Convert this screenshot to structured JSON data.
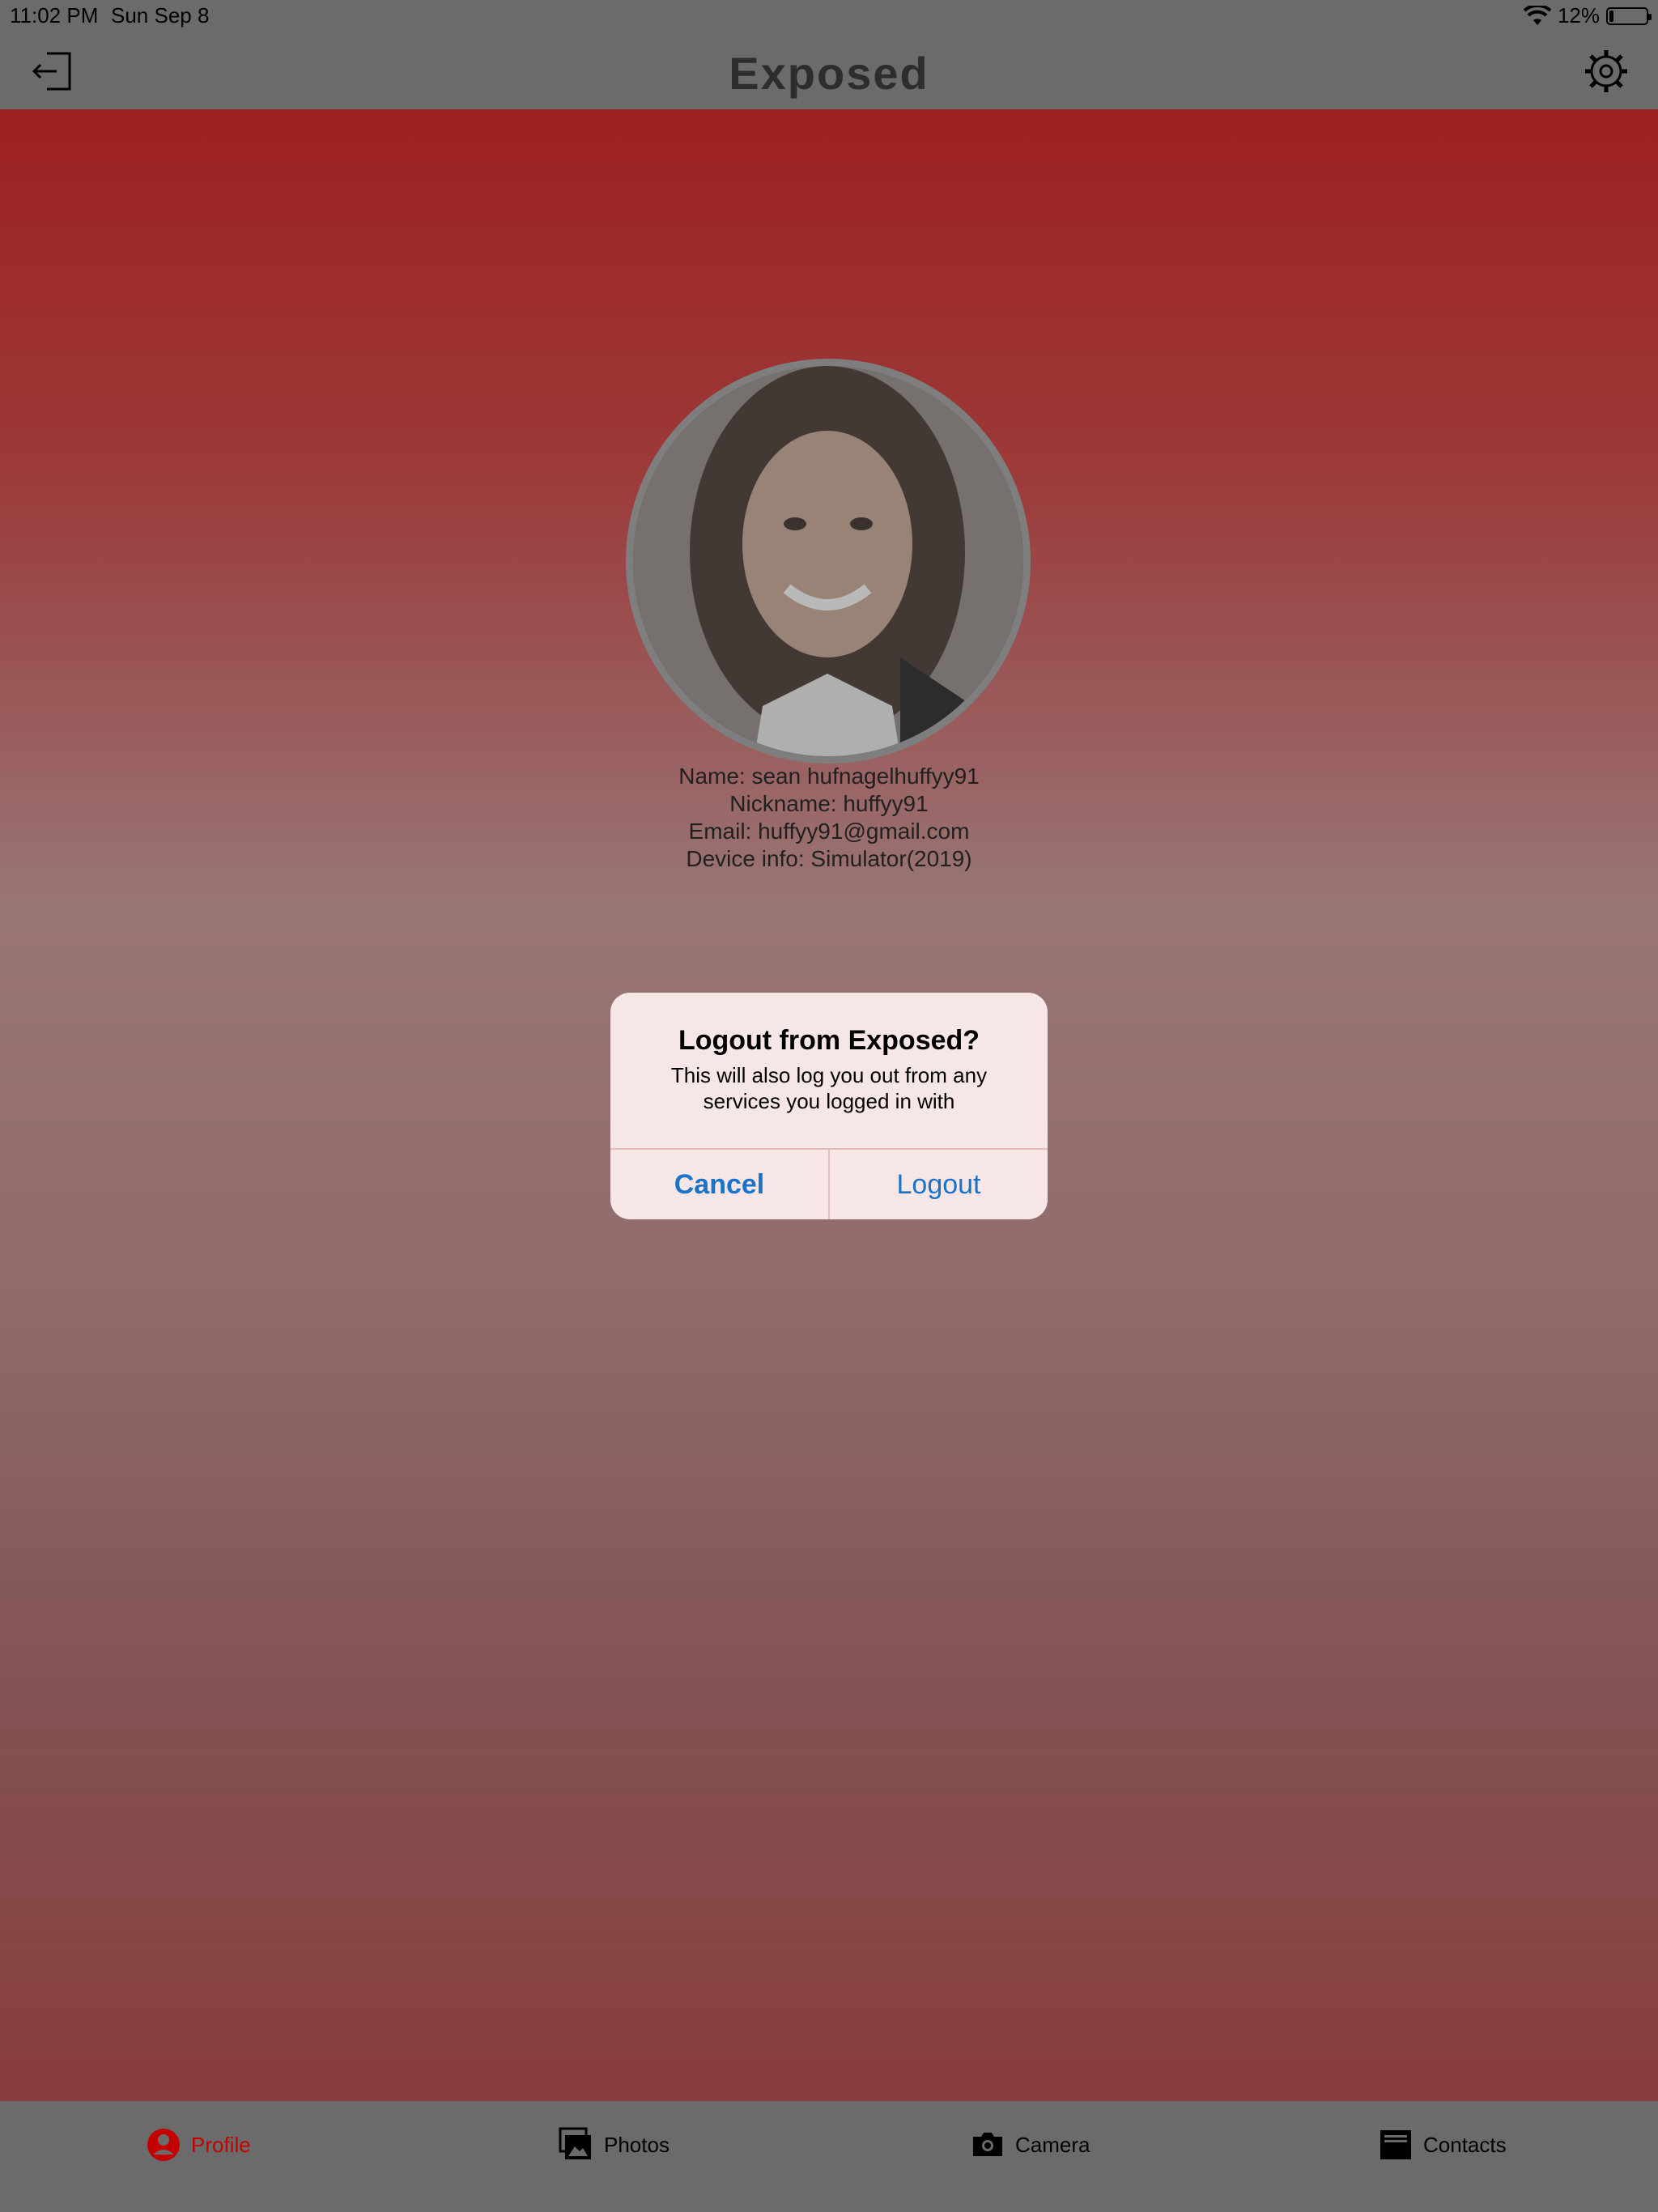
{
  "status_bar": {
    "time": "11:02 PM",
    "date": "Sun Sep 8",
    "battery_percent": "12%",
    "battery_level": 0.12
  },
  "nav": {
    "title": "Exposed",
    "left_icon": "logout-icon",
    "right_icon": "gear-icon"
  },
  "profile": {
    "name": "Name: sean hufnagelhuffyy91",
    "nickname": "Nickname: huffyy91",
    "email": "Email: huffyy91@gmail.com",
    "device": "Device info: Simulator(2019)"
  },
  "alert": {
    "title": "Logout from Exposed?",
    "message": "This will also log you out from any services you logged in with",
    "cancel_label": "Cancel",
    "logout_label": "Logout"
  },
  "tabs": [
    {
      "label": "Profile",
      "icon": "person-icon",
      "active": true
    },
    {
      "label": "Photos",
      "icon": "photos-icon",
      "active": false
    },
    {
      "label": "Camera",
      "icon": "camera-icon",
      "active": false
    },
    {
      "label": "Contacts",
      "icon": "contacts-icon",
      "active": false
    }
  ],
  "colors": {
    "accent": "#c40000",
    "link": "#1a73c9",
    "bar": "#6b6b6b"
  }
}
